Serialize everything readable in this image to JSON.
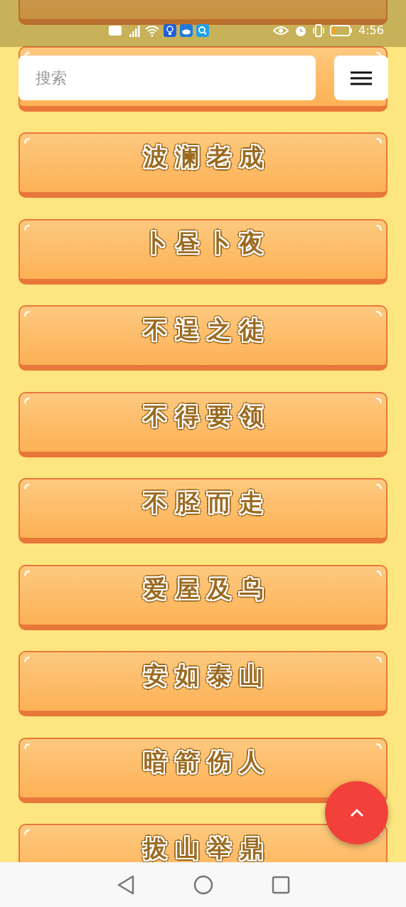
{
  "status_bar": {
    "time": "4:56"
  },
  "search": {
    "placeholder": "搜索"
  },
  "items": [
    {
      "kind": "cut"
    },
    {
      "kind": "covered"
    },
    {
      "kind": "label",
      "label": "波澜老成"
    },
    {
      "kind": "label",
      "label": "卜昼卜夜"
    },
    {
      "kind": "label",
      "label": "不逞之徒"
    },
    {
      "kind": "label",
      "label": "不得要领"
    },
    {
      "kind": "label",
      "label": "不胫而走"
    },
    {
      "kind": "label",
      "label": "爱屋及乌"
    },
    {
      "kind": "label",
      "label": "安如泰山"
    },
    {
      "kind": "label",
      "label": "暗箭伤人"
    },
    {
      "kind": "label",
      "label": "拔山举鼎"
    }
  ]
}
